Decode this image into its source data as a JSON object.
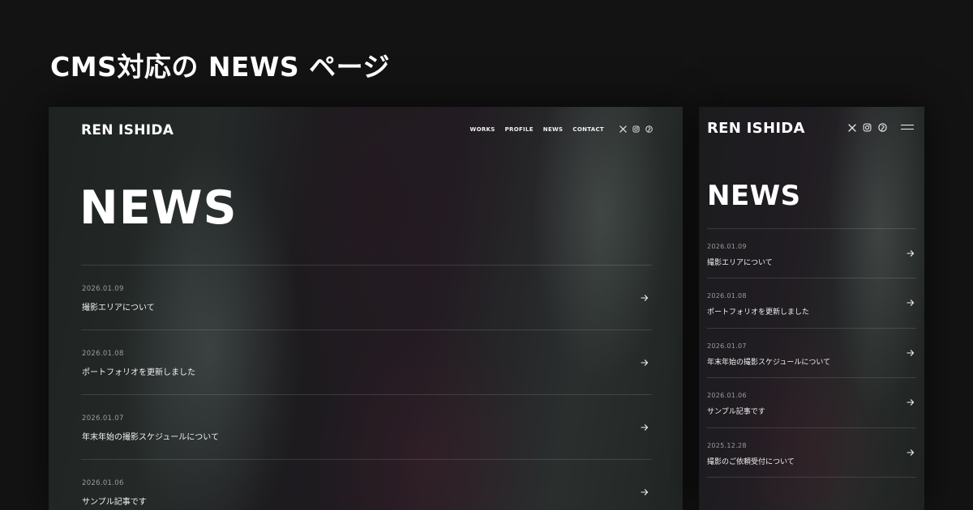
{
  "heading": "CMS対応の NEWS ページ",
  "site": {
    "brand": "REN ISHIDA",
    "nav": [
      "WORKS",
      "PROFILE",
      "NEWS",
      "CONTACT"
    ],
    "social_icons": [
      "x-icon",
      "instagram-icon",
      "pinterest-icon"
    ],
    "menu_icon": "hamburger-menu-icon"
  },
  "news": {
    "title": "NEWS",
    "items": [
      {
        "date": "2026.01.09",
        "title": "撮影エリアについて"
      },
      {
        "date": "2026.01.08",
        "title": "ポートフォリオを更新しました"
      },
      {
        "date": "2026.01.07",
        "title": "年末年始の撮影スケジュールについて"
      },
      {
        "date": "2026.01.06",
        "title": "サンプル記事です"
      },
      {
        "date": "2025.12.28",
        "title": "撮影のご依頼受付について"
      }
    ],
    "arrow_icon": "arrow-right-icon"
  },
  "colors": {
    "background": "#131313",
    "text": "#ffffff",
    "date_text": "#9a9c9b",
    "divider": "rgba(255,255,255,0.13)"
  }
}
